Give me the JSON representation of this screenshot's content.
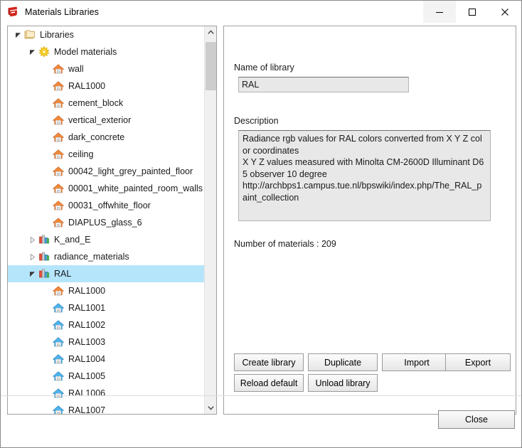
{
  "window": {
    "title": "Materials Libraries",
    "app_icon": "sketchup-logo-icon",
    "minimize_label": "—",
    "maximize_label": "□",
    "close_label": "✕"
  },
  "tree": {
    "items": [
      {
        "label": "Libraries",
        "indent": 0,
        "icon": "folder-icon",
        "state": "expanded",
        "selected": false
      },
      {
        "label": "Model materials",
        "indent": 1,
        "icon": "sun-icon",
        "state": "expanded",
        "selected": false
      },
      {
        "label": "wall",
        "indent": 2,
        "icon": "house-orange-icon",
        "state": "leaf",
        "selected": false
      },
      {
        "label": "RAL1000",
        "indent": 2,
        "icon": "house-orange-icon",
        "state": "leaf",
        "selected": false
      },
      {
        "label": "cement_block",
        "indent": 2,
        "icon": "house-orange-icon",
        "state": "leaf",
        "selected": false
      },
      {
        "label": "vertical_exterior",
        "indent": 2,
        "icon": "house-orange-icon",
        "state": "leaf",
        "selected": false
      },
      {
        "label": "dark_concrete",
        "indent": 2,
        "icon": "house-orange-icon",
        "state": "leaf",
        "selected": false
      },
      {
        "label": "ceiling",
        "indent": 2,
        "icon": "house-orange-icon",
        "state": "leaf",
        "selected": false
      },
      {
        "label": "00042_light_grey_painted_floor",
        "indent": 2,
        "icon": "house-orange-icon",
        "state": "leaf",
        "selected": false
      },
      {
        "label": "00001_white_painted_room_walls",
        "indent": 2,
        "icon": "house-orange-icon",
        "state": "leaf",
        "selected": false
      },
      {
        "label": "00031_offwhite_floor",
        "indent": 2,
        "icon": "house-orange-icon",
        "state": "leaf",
        "selected": false
      },
      {
        "label": "DIAPLUS_glass_6",
        "indent": 2,
        "icon": "house-orange-icon",
        "state": "leaf",
        "selected": false
      },
      {
        "label": "K_and_E",
        "indent": 1,
        "icon": "library-bars-icon",
        "state": "collapsed",
        "selected": false
      },
      {
        "label": "radiance_materials",
        "indent": 1,
        "icon": "library-bars-icon",
        "state": "collapsed",
        "selected": false
      },
      {
        "label": "RAL",
        "indent": 1,
        "icon": "library-bars-icon",
        "state": "expanded",
        "selected": true
      },
      {
        "label": "RAL1000",
        "indent": 2,
        "icon": "house-orange-icon",
        "state": "leaf",
        "selected": false
      },
      {
        "label": "RAL1001",
        "indent": 2,
        "icon": "house-blue-icon",
        "state": "leaf",
        "selected": false
      },
      {
        "label": "RAL1002",
        "indent": 2,
        "icon": "house-blue-icon",
        "state": "leaf",
        "selected": false
      },
      {
        "label": "RAL1003",
        "indent": 2,
        "icon": "house-blue-icon",
        "state": "leaf",
        "selected": false
      },
      {
        "label": "RAL1004",
        "indent": 2,
        "icon": "house-blue-icon",
        "state": "leaf",
        "selected": false
      },
      {
        "label": "RAL1005",
        "indent": 2,
        "icon": "house-blue-icon",
        "state": "leaf",
        "selected": false
      },
      {
        "label": "RAL1006",
        "indent": 2,
        "icon": "house-blue-icon",
        "state": "leaf",
        "selected": false
      },
      {
        "label": "RAL1007",
        "indent": 2,
        "icon": "house-blue-icon",
        "state": "leaf",
        "selected": false
      }
    ],
    "scrollbar": {
      "up_arrow": "▲",
      "down_arrow": "▼"
    }
  },
  "details": {
    "name_label": "Name of library",
    "name_value": "RAL",
    "description_label": "Description",
    "description_value": "Radiance rgb values for RAL colors converted from X Y Z color coordinates\nX Y Z values measured with Minolta CM-2600D Illuminant D65 observer 10 degree\nhttp://archbps1.campus.tue.nl/bpswiki/index.php/The_RAL_paint_collection",
    "materials_count_text": "Number of materials : 209",
    "buttons": {
      "create_library": "Create library",
      "duplicate": "Duplicate",
      "import": "Import",
      "export": "Export",
      "reload_default": "Reload default",
      "unload_library": "Unload library"
    }
  },
  "footer": {
    "close_label": "Close"
  },
  "colors": {
    "selection": "#b5e5fb",
    "field_bg": "#e8e8e8",
    "accent_red": "#d32218"
  }
}
